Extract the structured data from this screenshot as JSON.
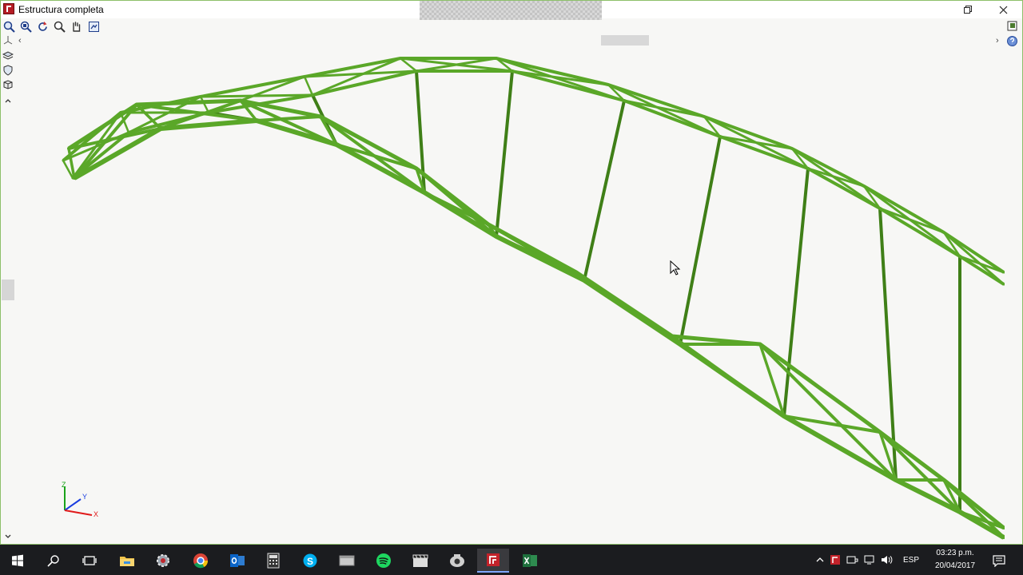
{
  "window": {
    "title": "Estructura completa"
  },
  "taskbar": {
    "apps": [
      {
        "name": "start-button",
        "icon": "windows-icon"
      },
      {
        "name": "search-button",
        "icon": "search-icon"
      },
      {
        "name": "task-view-button",
        "icon": "task-view-icon"
      },
      {
        "name": "file-explorer",
        "icon": "folder-icon"
      },
      {
        "name": "app-settings",
        "icon": "gear-icon"
      },
      {
        "name": "chrome",
        "icon": "chrome-icon"
      },
      {
        "name": "outlook",
        "icon": "outlook-icon"
      },
      {
        "name": "calculator",
        "icon": "calculator-icon"
      },
      {
        "name": "skype",
        "icon": "skype-icon"
      },
      {
        "name": "app-generic",
        "icon": "window-icon"
      },
      {
        "name": "spotify",
        "icon": "spotify-icon"
      },
      {
        "name": "video-editor",
        "icon": "clapper-icon"
      },
      {
        "name": "app-capture",
        "icon": "camera-icon"
      },
      {
        "name": "structural-app",
        "icon": "structural-app-icon"
      },
      {
        "name": "excel",
        "icon": "excel-icon"
      }
    ],
    "language": "ESP",
    "time": "03:23 p.m.",
    "date": "20/04/2017"
  },
  "colors": {
    "truss": "#5aa728",
    "truss_dark": "#3f7f17",
    "background": "#f7f7f5",
    "taskbar": "#1b1c1f"
  }
}
